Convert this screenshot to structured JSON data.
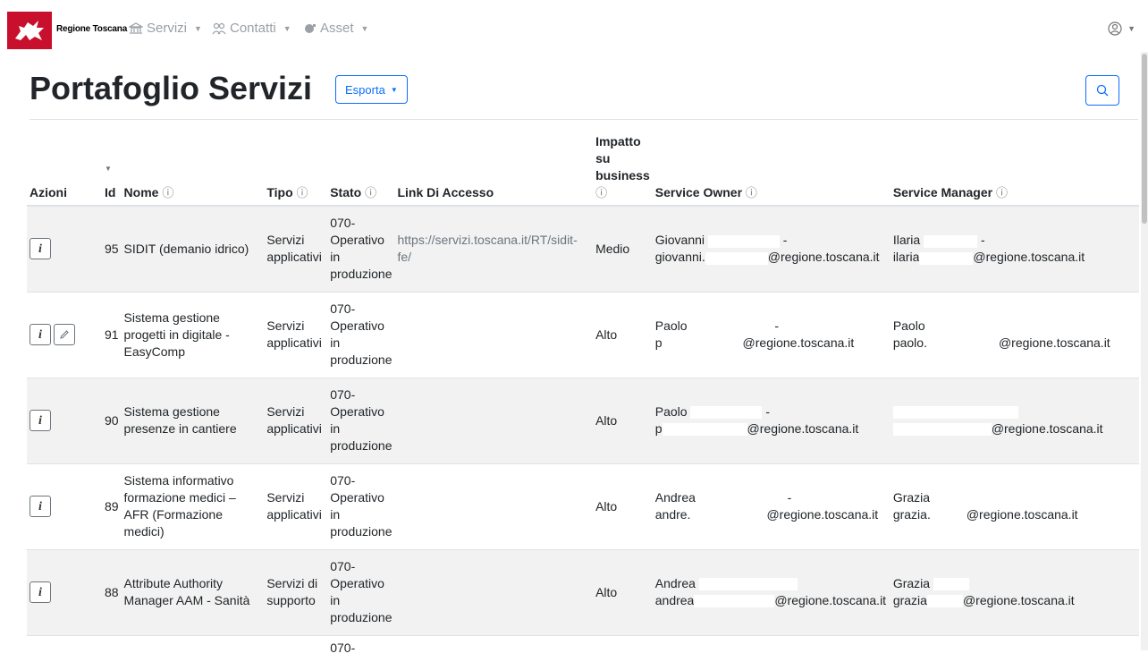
{
  "brand": "Regione Toscana",
  "nav": [
    {
      "label": "Servizi",
      "icon": "bank-icon"
    },
    {
      "label": "Contatti",
      "icon": "users-icon"
    },
    {
      "label": "Asset",
      "icon": "asset-icon"
    }
  ],
  "page": {
    "title": "Portafoglio Servizi",
    "export_label": "Esporta"
  },
  "table": {
    "headers": {
      "azioni": "Azioni",
      "id": "Id",
      "nome": "Nome",
      "tipo": "Tipo",
      "stato": "Stato",
      "link": "Link Di Accesso",
      "impatto": "Impatto su business",
      "owner": "Service Owner",
      "manager": "Service Manager"
    },
    "rows": [
      {
        "id": "95",
        "nome": "SIDIT (demanio idrico)",
        "tipo": "Servizi applicativi",
        "stato": "070- Operativo in produzione",
        "link": "https://servizi.toscana.it/RT/sidit-fe/",
        "impatto": "Medio",
        "owner_name": "Giovanni",
        "owner_mail_a": "giovanni.",
        "owner_mail_b": "@regione.toscana.it",
        "manager_name": "Ilaria",
        "manager_mail_a": "ilaria",
        "manager_mail_b": "@regione.toscana.it",
        "editable": false
      },
      {
        "id": "91",
        "nome": "Sistema gestione progetti in digitale - EasyComp",
        "tipo": "Servizi applicativi",
        "stato": "070- Operativo in produzione",
        "link": "",
        "impatto": "Alto",
        "owner_name": "Paolo",
        "owner_mail_a": "p",
        "owner_mail_b": "@regione.toscana.it",
        "manager_name": "Paolo",
        "manager_mail_a": "paolo.",
        "manager_mail_b": "@regione.toscana.it",
        "editable": true
      },
      {
        "id": "90",
        "nome": "Sistema gestione presenze in cantiere",
        "tipo": "Servizi applicativi",
        "stato": "070- Operativo in produzione",
        "link": "",
        "impatto": "Alto",
        "owner_name": "Paolo",
        "owner_mail_a": "p",
        "owner_mail_b": "@regione.toscana.it",
        "manager_name": "",
        "manager_mail_a": "",
        "manager_mail_b": "@regione.toscana.it",
        "editable": false
      },
      {
        "id": "89",
        "nome": "Sistema informativo formazione medici – AFR (Formazione medici)",
        "tipo": "Servizi applicativi",
        "stato": "070- Operativo in produzione",
        "link": "",
        "impatto": "Alto",
        "owner_name": "Andrea",
        "owner_mail_a": "andre.",
        "owner_mail_b": "@regione.toscana.it",
        "manager_name": "Grazia",
        "manager_mail_a": "grazia.",
        "manager_mail_b": "@regione.toscana.it",
        "editable": false
      },
      {
        "id": "88",
        "nome": "Attribute Authority Manager AAM - Sanità",
        "tipo": "Servizi di supporto",
        "stato": "070- Operativo in produzione",
        "link": "",
        "impatto": "Alto",
        "owner_name": "Andrea",
        "owner_mail_a": "andrea",
        "owner_mail_b": "@regione.toscana.it",
        "manager_name": "Grazia",
        "manager_mail_a": "grazia",
        "manager_mail_b": "@regione.toscana.it",
        "editable": false
      }
    ],
    "partial_row_stato": "070-"
  },
  "colors": {
    "primary": "#0d6efd",
    "stripe": "#f2f2f2",
    "logo_red": "#c8102e"
  }
}
